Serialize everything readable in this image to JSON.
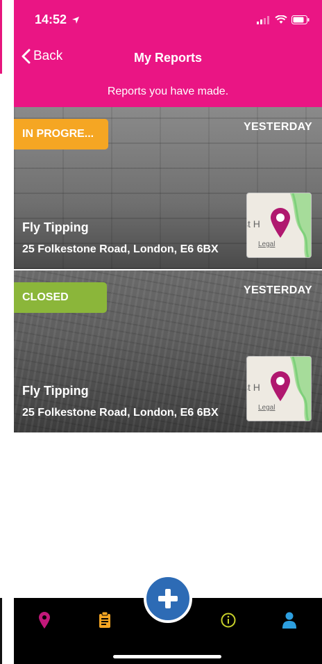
{
  "status_bar": {
    "time": "14:52"
  },
  "nav": {
    "back_label": "Back",
    "title": "My Reports"
  },
  "subtitle": "Reports you have made.",
  "reports": [
    {
      "status": "IN PROGRE...",
      "date": "YESTERDAY",
      "title": "Fly Tipping",
      "address": "25 Folkestone Road, London, E6 6BX",
      "map_text": "st H",
      "map_legal": "Legal",
      "status_color": "#f5a623"
    },
    {
      "status": "CLOSED",
      "date": "YESTERDAY",
      "title": "Fly Tipping",
      "address": "25 Folkestone Road, London, E6 6BX",
      "map_text": "st H",
      "map_legal": "Legal",
      "status_color": "#8bb63a"
    }
  ],
  "tab_bar": {
    "icons": [
      "map-pin-icon",
      "clipboard-icon",
      "plus-icon",
      "info-icon",
      "user-icon"
    ],
    "colors": {
      "pin": "#c2187a",
      "clipboard": "#f5a623",
      "fab": "#2d6bb5",
      "info": "#c8d12a",
      "user": "#2d9fe0"
    }
  },
  "theme": {
    "brand": "#ea1584"
  }
}
